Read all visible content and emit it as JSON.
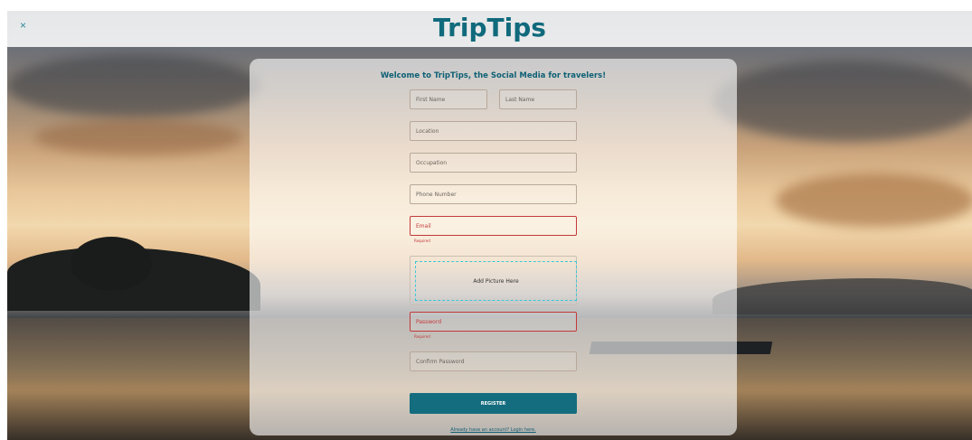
{
  "header": {
    "brand": "TripTips",
    "close_label": "×"
  },
  "form": {
    "welcome": "Welcome to TripTips, the Social Media for travelers!",
    "first_name_placeholder": "First Name",
    "last_name_placeholder": "Last Name",
    "location_placeholder": "Location",
    "occupation_placeholder": "Occupation",
    "phone_placeholder": "Phone Number",
    "email_placeholder": "Email",
    "email_error": "Required",
    "picture_label": "Add Picture Here",
    "password_placeholder": "Password",
    "password_error": "Required",
    "confirm_password_placeholder": "Confirm Password",
    "register_label": "REGISTER",
    "login_link": "Already have an account? Login here."
  },
  "colors": {
    "brand": "#106a7c",
    "button": "#136d7e",
    "error": "#c23a3a",
    "dropzone_border": "#3cc8d6"
  }
}
